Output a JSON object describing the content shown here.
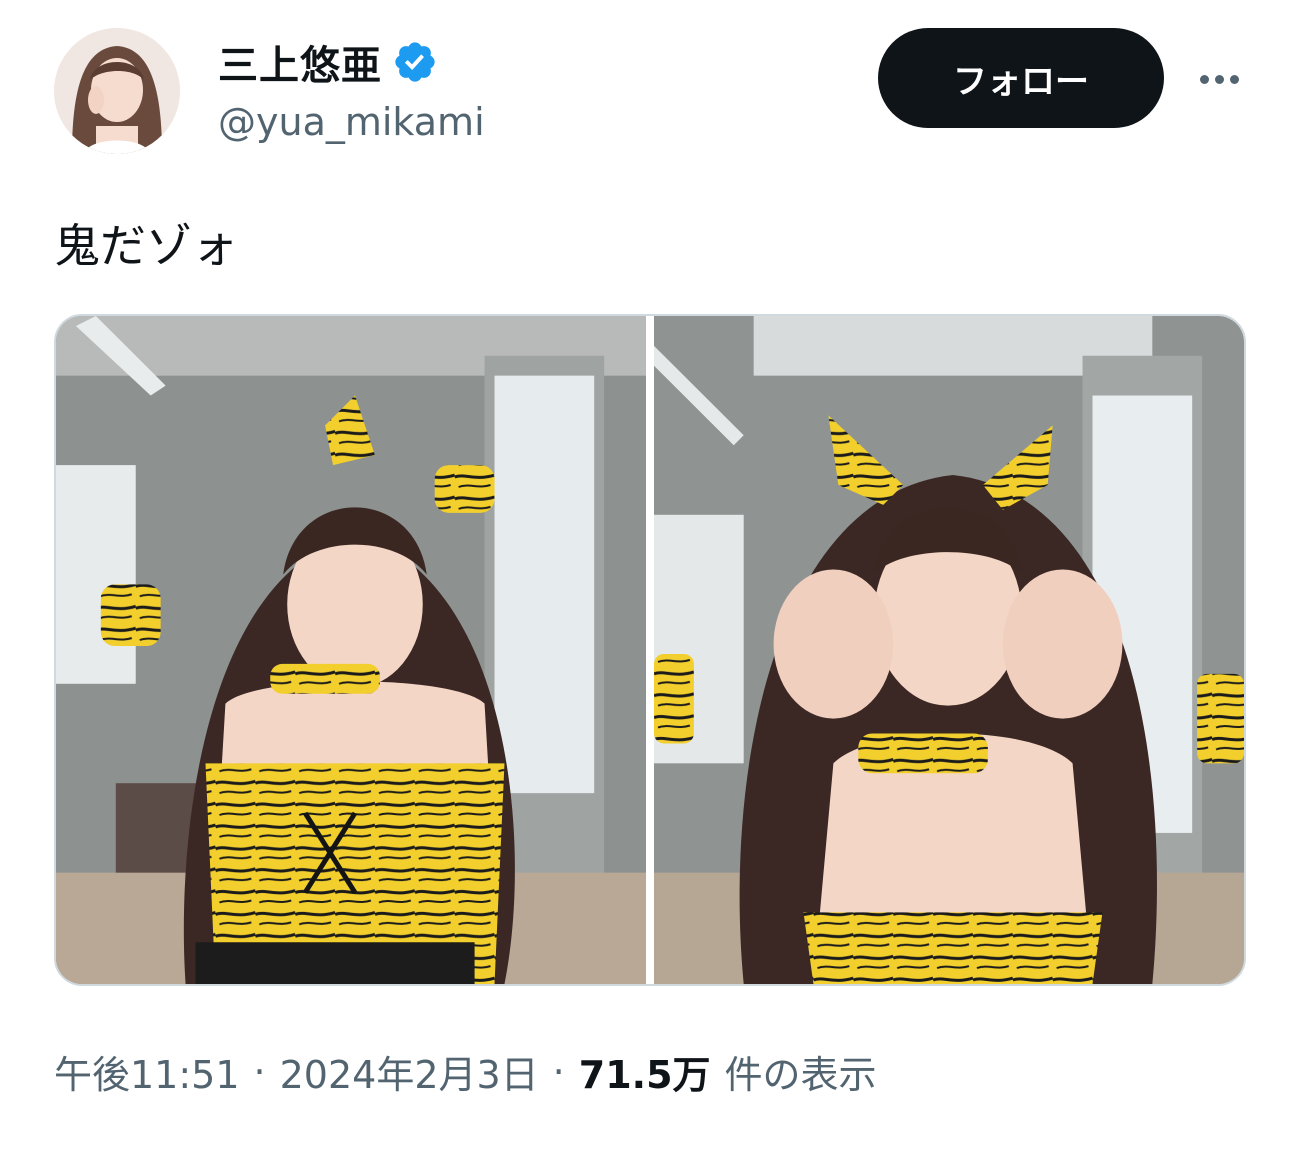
{
  "user": {
    "display_name": "三上悠亜",
    "handle": "@yua_mikami",
    "verified": true,
    "avatar_icon": "profile-photo"
  },
  "actions": {
    "follow_label": "フォロー",
    "more_icon": "more-horizontal-icon"
  },
  "tweet": {
    "text": "鬼だゾォ",
    "media": [
      {
        "type": "photo",
        "icon": "photo-tiger-costume-arms-up"
      },
      {
        "type": "photo",
        "icon": "photo-tiger-costume-hands-cheeks"
      }
    ]
  },
  "meta": {
    "time": "午後11:51",
    "separator": "·",
    "date": "2024年2月3日",
    "views_count": "71.5万",
    "views_label": "件の表示"
  },
  "colors": {
    "text_primary": "#0f1419",
    "text_secondary": "#536471",
    "verified_blue": "#1d9bf0",
    "border": "#cfd9de"
  }
}
